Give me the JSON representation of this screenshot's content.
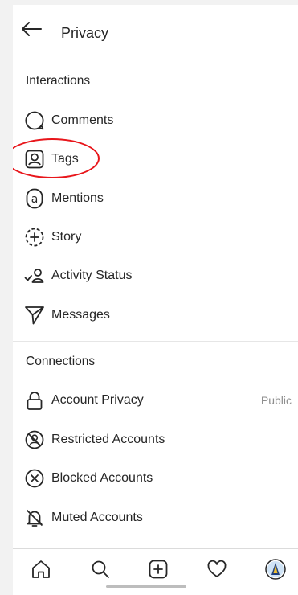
{
  "header": {
    "title": "Privacy"
  },
  "interactions": {
    "title": "Interactions",
    "items": [
      {
        "label": "Comments",
        "icon": "comment-icon"
      },
      {
        "label": "Tags",
        "icon": "tag-person-icon"
      },
      {
        "label": "Mentions",
        "icon": "at-sign-icon"
      },
      {
        "label": "Story",
        "icon": "story-add-icon"
      },
      {
        "label": "Activity Status",
        "icon": "activity-status-icon"
      },
      {
        "label": "Messages",
        "icon": "paper-plane-icon"
      }
    ]
  },
  "connections": {
    "title": "Connections",
    "items": [
      {
        "label": "Account Privacy",
        "value": "Public",
        "icon": "lock-icon"
      },
      {
        "label": "Restricted Accounts",
        "icon": "restricted-icon"
      },
      {
        "label": "Blocked Accounts",
        "icon": "blocked-icon"
      },
      {
        "label": "Muted Accounts",
        "icon": "muted-bell-icon"
      }
    ]
  },
  "tabbar": {
    "items": [
      "home-icon",
      "search-icon",
      "new-post-icon",
      "activity-heart-icon",
      "profile-avatar"
    ]
  },
  "colors": {
    "highlight": "#e8161b",
    "text": "#262626",
    "secondary": "#8e8e8e"
  }
}
